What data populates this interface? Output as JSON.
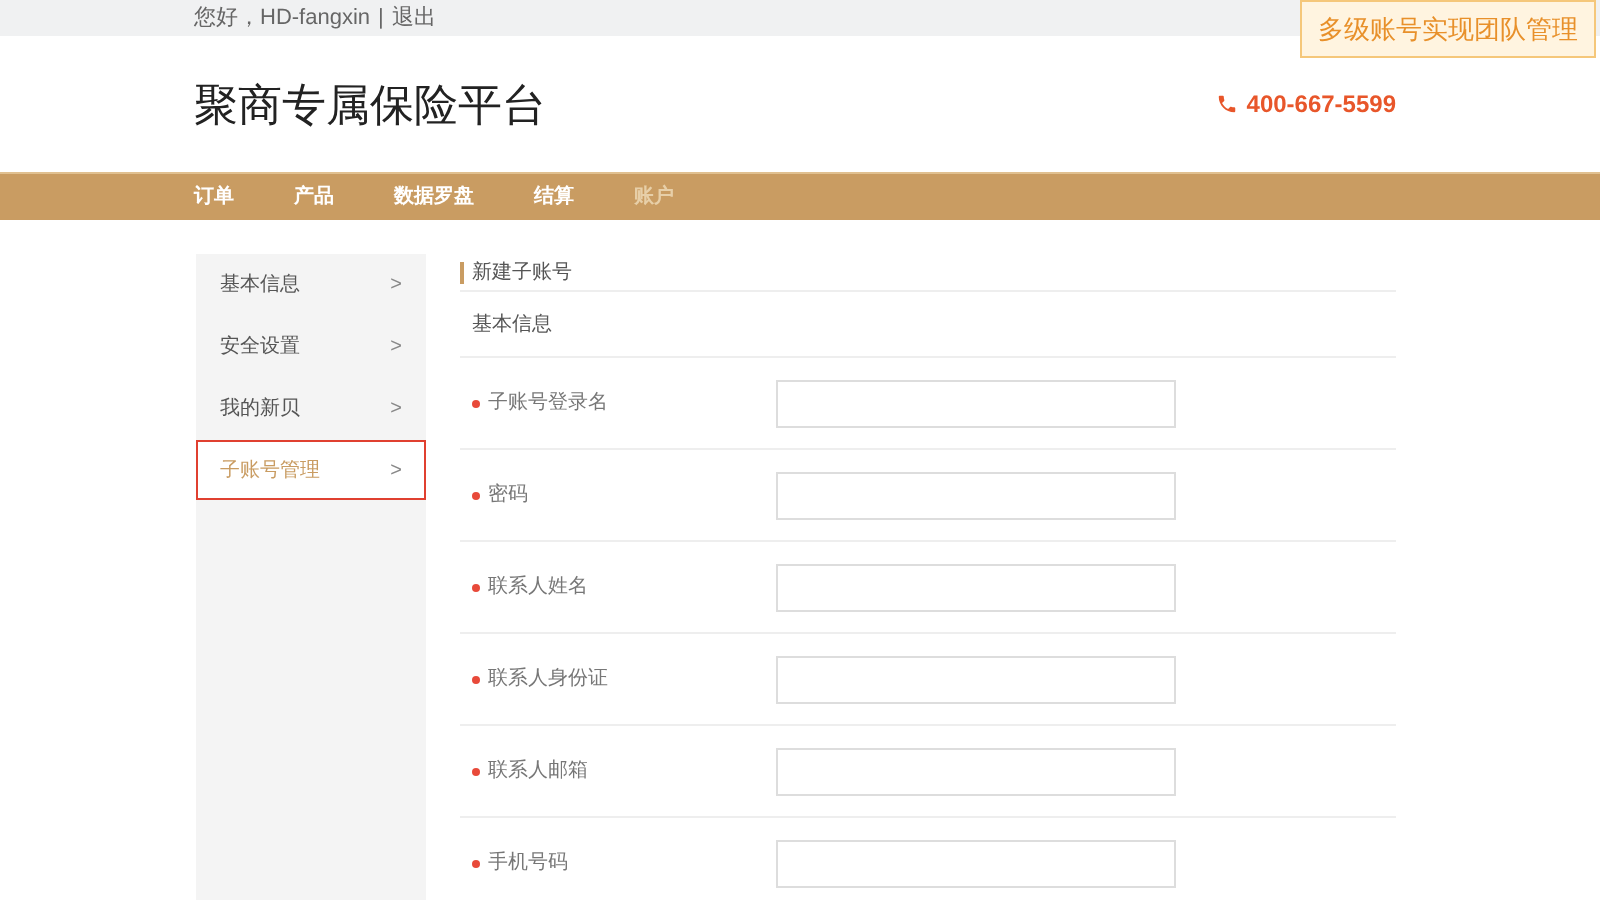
{
  "top_bar": {
    "greeting": "您好，HD-fangxin",
    "separator": "|",
    "logout": "退出"
  },
  "callout": "多级账号实现团队管理",
  "header": {
    "title": "聚商专属保险平台",
    "phone": "400-667-5599"
  },
  "nav": [
    {
      "label": "订单",
      "selected": false
    },
    {
      "label": "产品",
      "selected": false
    },
    {
      "label": "数据罗盘",
      "selected": false
    },
    {
      "label": "结算",
      "selected": false
    },
    {
      "label": "账户",
      "selected": true
    }
  ],
  "sidebar": {
    "items": [
      {
        "label": "基本信息",
        "arrow": ">",
        "selected": false
      },
      {
        "label": "安全设置",
        "arrow": ">",
        "selected": false
      },
      {
        "label": "我的新贝",
        "arrow": ">",
        "selected": false
      },
      {
        "label": "子账号管理",
        "arrow": ">",
        "selected": true
      }
    ]
  },
  "form": {
    "title": "新建子账号",
    "section": "基本信息",
    "fields": [
      {
        "label": "子账号登录名",
        "required": true
      },
      {
        "label": "密码",
        "required": true
      },
      {
        "label": "联系人姓名",
        "required": true
      },
      {
        "label": "联系人身份证",
        "required": true
      },
      {
        "label": "联系人邮箱",
        "required": true
      },
      {
        "label": "手机号码",
        "required": true
      }
    ]
  }
}
